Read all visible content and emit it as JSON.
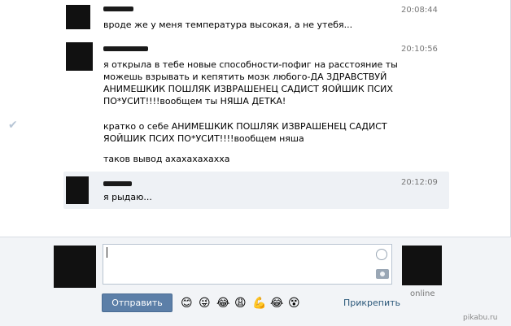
{
  "messages": [
    {
      "time": "20:08:44",
      "text": "вроде же у меня температура высокая, а не утебя..."
    },
    {
      "time": "20:10:56",
      "paragraphs": [
        "я открыла в тебе новые способности-пофиг на расстояние ты\nможешь взрывать и кепятить мозк любого-ДА ЗДРАВСТВУЙ\nАНИМЕШКИК ПОШЛЯК ИЗВРАШЕНЕЦ САДИСТ ЯОЙШИК ПСИХ\nПО*УСИТ!!!!вообщем ты НЯША ДЕТКА!",
        "кратко о себе АНИМЕШКИК ПОШЛЯК ИЗВРАШЕНЕЦ САДИСТ\nЯОЙШИК ПСИХ ПО*УСИТ!!!!вообщем няша",
        "таков вывод ахахахахахха"
      ]
    },
    {
      "time": "20:12:09",
      "text": "я рыдаю..."
    }
  ],
  "compose": {
    "send_label": "Отправить",
    "attach_label": "Прикрепить",
    "status": "online",
    "emojis": [
      "😊",
      "😜",
      "😂",
      "😩",
      "💪",
      "😂",
      "😵"
    ]
  },
  "watermark": "pikabu.ru"
}
